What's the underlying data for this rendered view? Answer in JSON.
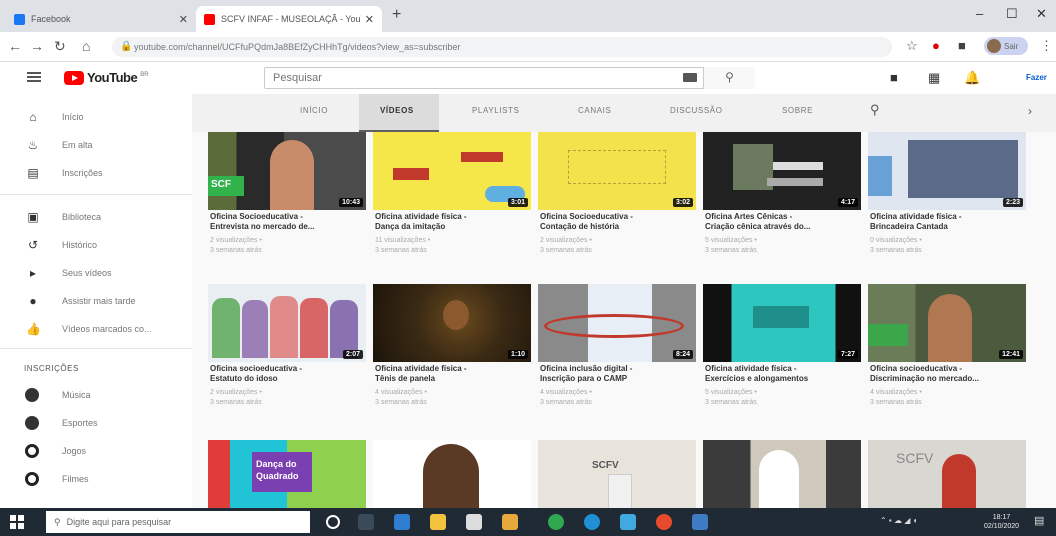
{
  "browser": {
    "tabs": [
      {
        "title": "Facebook",
        "favicon_color": "#1877f2"
      },
      {
        "title": "SCFV INFAF - MUSEOLAÇÃ - YouTube",
        "favicon_color": "#ff0000"
      }
    ],
    "new_tab": "+",
    "url": "youtube.com/channel/UCFfuPQdmJa8BEfZyCHHhTg/videos?view_as=subscriber",
    "profile_label": "Sair"
  },
  "youtube": {
    "logo_text": "YouTube",
    "logo_suffix": "BR",
    "search_placeholder": "Pesquisar",
    "signin_label": "Fazer"
  },
  "sidebar": {
    "main": [
      {
        "label": "Início",
        "icon": "home-icon"
      },
      {
        "label": "Em alta",
        "icon": "flame-icon"
      },
      {
        "label": "Inscrições",
        "icon": "subscriptions-icon"
      }
    ],
    "library": [
      {
        "label": "Biblioteca",
        "icon": "library-icon"
      },
      {
        "label": "Histórico",
        "icon": "history-icon"
      },
      {
        "label": "Seus vídeos",
        "icon": "your-videos-icon"
      },
      {
        "label": "Assistir mais tarde",
        "icon": "watch-later-icon"
      },
      {
        "label": "Vídeos marcados co...",
        "icon": "liked-icon"
      }
    ],
    "subscriptions_header": "INSCRIÇÕES",
    "subscriptions": [
      {
        "label": "Música",
        "color": "#333"
      },
      {
        "label": "Esportes",
        "color": "#333"
      },
      {
        "label": "Jogos",
        "color": "#222"
      },
      {
        "label": "Filmes",
        "color": "#222"
      }
    ]
  },
  "channel_tabs": [
    "INÍCIO",
    "VÍDEOS",
    "PLAYLISTS",
    "CANAIS",
    "DISCUSSÃO",
    "SOBRE"
  ],
  "active_tab": "VÍDEOS",
  "videos": [
    {
      "title1": "Oficina Socioeducativa -",
      "title2": "Entrevista no mercado de...",
      "views": "2 visualizações •",
      "age": "3 semanas atrás",
      "duration": "10:43",
      "thumb": "#4a4a4a"
    },
    {
      "title1": "Oficina atividade física -",
      "title2": "Dança da imitação",
      "views": "11 visualizações •",
      "age": "3 semanas atrás",
      "duration": "3:01",
      "thumb": "#f5e64a"
    },
    {
      "title1": "Oficina Socioeducativa -",
      "title2": "Contação de história",
      "views": "2 visualizações •",
      "age": "3 semanas atrás",
      "duration": "3:02",
      "thumb": "#f3e24c"
    },
    {
      "title1": "Oficina Artes Cênicas -",
      "title2": "Criação cênica através do...",
      "views": "5 visualizações •",
      "age": "3 semanas atrás",
      "duration": "4:17",
      "thumb": "#222222"
    },
    {
      "title1": "Oficina atividade física -",
      "title2": "Brincadeira Cantada",
      "views": "0 visualizações •",
      "age": "3 semanas atrás",
      "duration": "2:23",
      "thumb": "#dfe6f0"
    },
    {
      "title1": "Oficina socioeducativa -",
      "title2": "Estatuto do idoso",
      "views": "2 visualizações •",
      "age": "3 semanas atrás",
      "duration": "2:07",
      "thumb": "#e9eef3"
    },
    {
      "title1": "Oficina atividade física -",
      "title2": "Tênis de panela",
      "views": "4 visualizações •",
      "age": "3 semanas atrás",
      "duration": "1:10",
      "thumb": "#3a2a14"
    },
    {
      "title1": "Oficina inclusão digital -",
      "title2": "Inscrição para o CAMP",
      "views": "4 visualizações •",
      "age": "3 semanas atrás",
      "duration": "8:24",
      "thumb": "#8a8a8a"
    },
    {
      "title1": "Oficina atividade física -",
      "title2": "Exercícios e alongamentos",
      "views": "5 visualizações •",
      "age": "3 semanas atrás",
      "duration": "7:27",
      "thumb": "#2ec7c0"
    },
    {
      "title1": "Oficina socioeducativa -",
      "title2": "Discriminação no mercado...",
      "views": "4 visualizações •",
      "age": "3 semanas atrás",
      "duration": "12:41",
      "thumb": "#6b7d58"
    },
    {
      "title1": "",
      "title2": "",
      "views": "",
      "age": "",
      "duration": "",
      "thumb": "#21c4d6",
      "overlay": "Dança do Quadrado"
    },
    {
      "title1": "",
      "title2": "",
      "views": "",
      "age": "",
      "duration": "",
      "thumb": "#ffffff"
    },
    {
      "title1": "",
      "title2": "",
      "views": "",
      "age": "",
      "duration": "",
      "thumb": "#e8e4dc",
      "overlay": "SCFV"
    },
    {
      "title1": "",
      "title2": "",
      "views": "",
      "age": "",
      "duration": "",
      "thumb": "#3b3b3b"
    },
    {
      "title1": "",
      "title2": "",
      "views": "",
      "age": "",
      "duration": "",
      "thumb": "#d9d7d2",
      "overlay": "SCFV"
    }
  ],
  "taskbar": {
    "search_placeholder": "Digite aqui para pesquisar",
    "time": "18:17",
    "date": "02/10/2020"
  }
}
